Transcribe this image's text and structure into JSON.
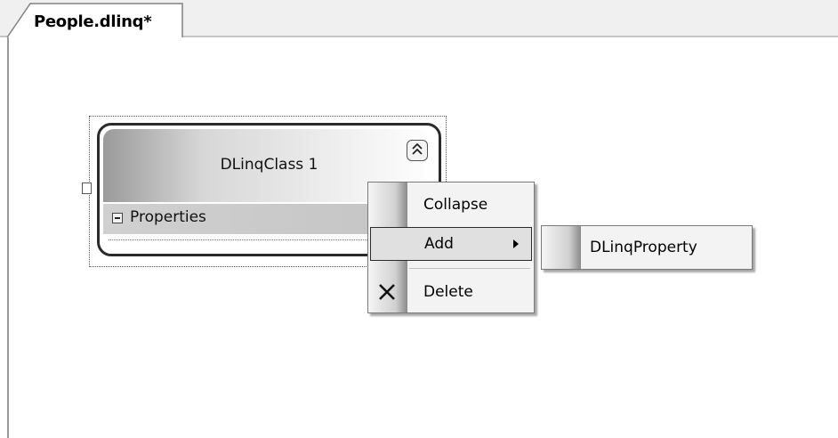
{
  "tab": {
    "title": "People.dlinq*"
  },
  "shape": {
    "title": "DLinqClass 1",
    "collapse_glyph": "⌃",
    "section_label": "Properties"
  },
  "context_menu": {
    "items": [
      {
        "label": "Collapse"
      },
      {
        "label": "Add",
        "has_submenu": true,
        "highlighted": true
      },
      {
        "label": "Delete",
        "icon": "delete-x-icon"
      }
    ]
  },
  "submenu": {
    "items": [
      {
        "label": "DLinqProperty"
      }
    ]
  },
  "colors": {
    "highlight": "#e0e0e0",
    "border": "#2a2a2a"
  }
}
